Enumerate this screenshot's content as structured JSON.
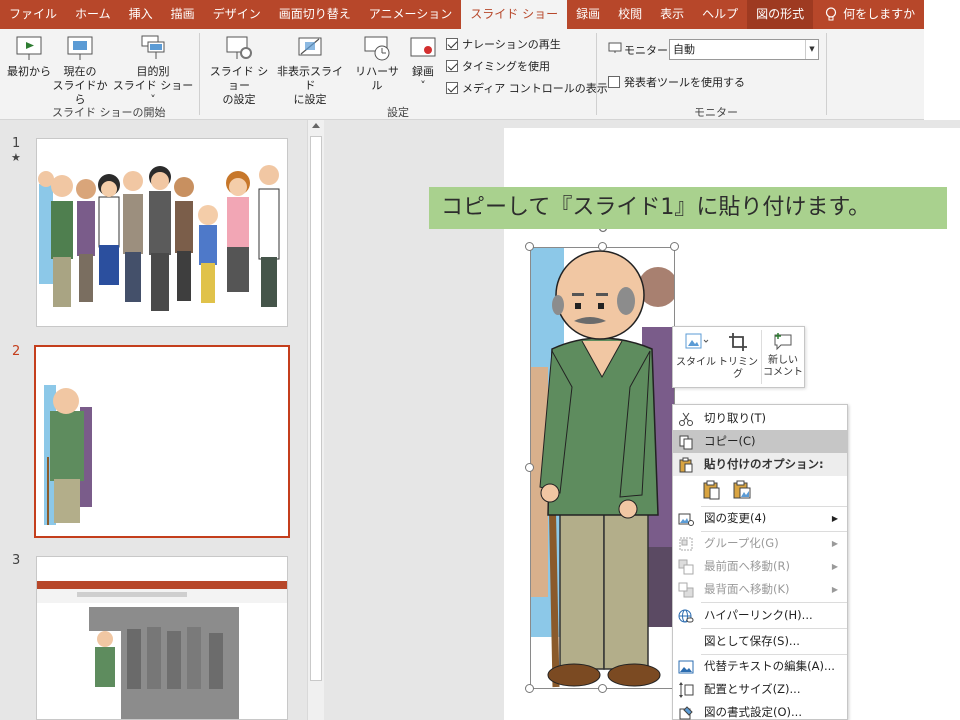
{
  "ribbon_tabs": [
    "ファイル",
    "ホーム",
    "挿入",
    "描画",
    "デザイン",
    "画面切り替え",
    "アニメーション",
    "スライド ショー",
    "録画",
    "校閲",
    "表示",
    "ヘルプ",
    "図の形式"
  ],
  "tell_me": "何をしますか",
  "ribbon": {
    "from_beginning": "最初から",
    "from_current_1": "現在の",
    "from_current_2": "スライドから",
    "custom_1": "目的別",
    "custom_2": "スライド ショー ˅",
    "setup_1": "スライド ショー",
    "setup_2": "の設定",
    "hide_1": "非表示スライド",
    "hide_2": "に設定",
    "rehearse": "リハーサル",
    "record": "録画",
    "record_arrow": "˅",
    "chk_narration": "ナレーションの再生",
    "chk_timing": "タイミングを使用",
    "chk_media": "メディア コントロールの表示",
    "monitor_label": "モニター:",
    "monitor_value": "自動",
    "presenter_view": "発表者ツールを使用する",
    "group_start": "スライド ショーの開始",
    "group_setup": "設定",
    "group_monitor": "モニター"
  },
  "slides": [
    {
      "number": "1",
      "star": "★"
    },
    {
      "number": "2"
    },
    {
      "number": "3"
    }
  ],
  "callout_text": "コピーして『スライド1』に貼り付けます。",
  "mini_toolbar": {
    "style": "スタイル",
    "trim": "トリミング",
    "comment_1": "新しい",
    "comment_2": "コメント"
  },
  "context_menu": {
    "cut": "切り取り(T)",
    "copy": "コピー(C)",
    "paste_options": "貼り付けのオプション:",
    "change_picture": "図の変更(4)",
    "group": "グループ化(G)",
    "bring_front": "最前面へ移動(R)",
    "send_back": "最背面へ移動(K)",
    "hyperlink": "ハイパーリンク(H)...",
    "save_as_picture": "図として保存(S)...",
    "alt_text": "代替テキストの編集(A)...",
    "size_position": "配置とサイズ(Z)...",
    "format_picture": "図の書式設定(O)..."
  },
  "colors": {
    "accent": "#b7472a",
    "callout_bg": "#a9d18e",
    "selection": "#c43e1c"
  }
}
